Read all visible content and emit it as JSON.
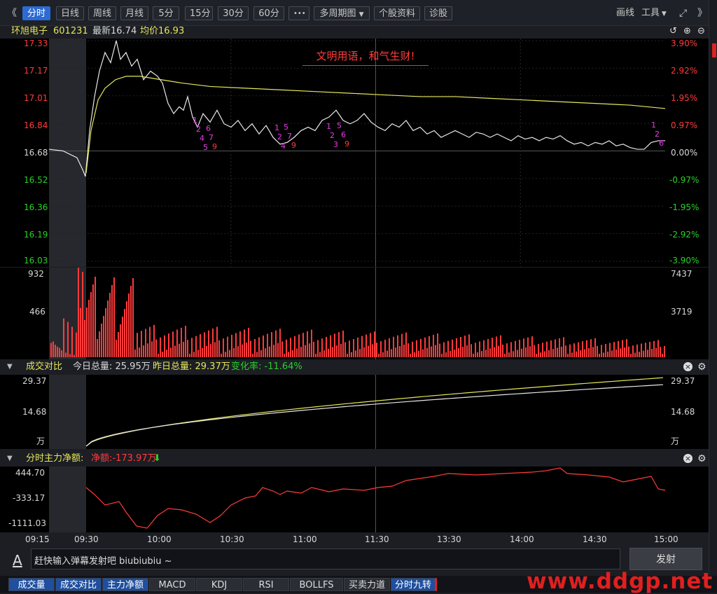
{
  "toolbar": {
    "collapse": "《",
    "tabs": [
      "分时",
      "日线",
      "周线",
      "月线",
      "5分",
      "15分",
      "30分",
      "60分"
    ],
    "more": "•••",
    "multi": "多周期图",
    "profile": "个股资料",
    "diag": "诊股",
    "draw": "画线",
    "tools": "工具",
    "expand": "⤢",
    "next": "》"
  },
  "stock": {
    "name": "环旭电子",
    "code": "601231",
    "last": "最新16.74",
    "avg": "均价16.93"
  },
  "main_chart": {
    "price_ticks": [
      "17.33",
      "17.17",
      "17.01",
      "16.84",
      "16.68",
      "16.52",
      "16.36",
      "16.19",
      "16.03"
    ],
    "pct_ticks": [
      "3.90%",
      "2.92%",
      "1.95%",
      "0.97%",
      "0.00%",
      "-0.97%",
      "-1.95%",
      "-2.92%",
      "-3.90%"
    ],
    "banner": "文明用语，和气生财!"
  },
  "volume_chart": {
    "left_ticks": [
      "932",
      "466"
    ],
    "right_ticks": [
      "7437",
      "3719"
    ]
  },
  "compare_panel": {
    "title": "成交对比",
    "today": "今日总量: 25.95万",
    "yesterday": "昨日总量: 29.37万",
    "change": "变化率: -11.64%",
    "left_ticks": [
      "29.37",
      "14.68",
      "万"
    ],
    "right_ticks": [
      "29.37",
      "14.68",
      "万"
    ]
  },
  "flow_panel": {
    "title": "分时主力净额:",
    "net": "净额:-173.97万",
    "ticks": [
      "444.70",
      "-333.17",
      "-1111.03"
    ]
  },
  "time_axis": [
    "09:15",
    "09:30",
    "10:00",
    "10:30",
    "11:00",
    "11:30",
    "13:30",
    "14:00",
    "14:30",
    "15:00"
  ],
  "danmaku": {
    "icon": "A",
    "placeholder": "赶快输入弹幕发射吧 biubiubiu ~",
    "send": "发射"
  },
  "bottom_tabs": [
    "成交量",
    "成交对比",
    "主力净额",
    "MACD",
    "KDJ",
    "RSI",
    "BOLLFS",
    "买卖力道",
    "分时九转"
  ],
  "watermark": "www.ddgp.net",
  "chart_data": {
    "type": "line",
    "title": "环旭电子 601231 分时",
    "x": [
      "09:30",
      "10:00",
      "10:30",
      "11:00",
      "11:30",
      "13:30",
      "14:00",
      "14:30",
      "15:00"
    ],
    "series": [
      {
        "name": "price",
        "values": [
          16.56,
          17.15,
          16.9,
          16.72,
          16.92,
          16.76,
          16.72,
          16.7,
          16.74
        ]
      },
      {
        "name": "avg",
        "values": [
          16.62,
          17.1,
          17.06,
          17.05,
          17.01,
          16.98,
          16.97,
          16.95,
          16.93
        ]
      }
    ],
    "ylim": [
      16.03,
      17.33
    ],
    "colors": {
      "price": "#e8e8e8",
      "avg": "#e6e65a"
    }
  }
}
